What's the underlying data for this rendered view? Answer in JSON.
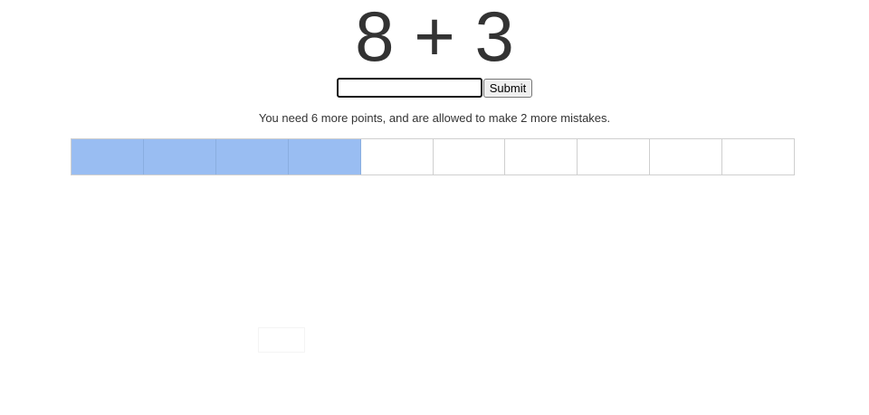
{
  "problem": {
    "text": "8 + 3"
  },
  "answer": {
    "value": "",
    "placeholder": ""
  },
  "submit_label": "Submit",
  "status": "You need 6 more points, and are allowed to make 2 more mistakes.",
  "progress": {
    "total_cells": 10,
    "filled_cells": 4,
    "fill_color": "#99bdf2"
  }
}
